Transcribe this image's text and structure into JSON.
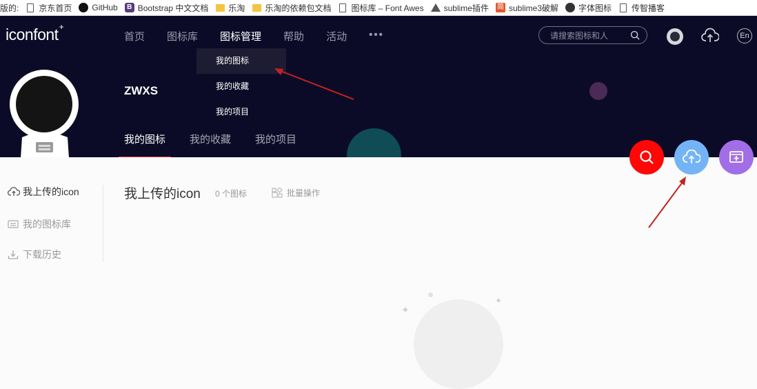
{
  "bookmarks": [
    {
      "label": "版的:",
      "icon": "file-icon"
    },
    {
      "label": "京东首页",
      "icon": "file-icon"
    },
    {
      "label": "GitHub",
      "icon": "github-icon"
    },
    {
      "label": "Bootstrap 中文文档",
      "icon": "bootstrap-icon"
    },
    {
      "label": "乐淘",
      "icon": "folder-icon"
    },
    {
      "label": "乐淘的依赖包文档",
      "icon": "folder-icon"
    },
    {
      "label": "图标库 – Font Awes",
      "icon": "file-icon"
    },
    {
      "label": "sublime插件",
      "icon": "triangle-icon"
    },
    {
      "label": "sublime3破解",
      "icon": "jian-icon"
    },
    {
      "label": "字体图标",
      "icon": "gear-icon"
    },
    {
      "label": "传智播客",
      "icon": "file-icon"
    }
  ],
  "header": {
    "logo": "iconfont",
    "logo_mark": "+",
    "nav": [
      "首页",
      "图标库",
      "图标管理",
      "帮助",
      "活动",
      "•••"
    ],
    "active_nav": "图标管理",
    "search_placeholder": "请搜索图标和人",
    "lang": "En"
  },
  "dropdown": [
    "我的图标",
    "我的收藏",
    "我的项目"
  ],
  "profile": {
    "username": "ZWXS",
    "tabs": [
      "我的图标",
      "我的收藏",
      "我的项目"
    ]
  },
  "sidebar": {
    "items": [
      {
        "label": "我上传的icon",
        "icon": "cloud-upload-icon"
      },
      {
        "label": "我的图标库",
        "icon": "library-icon"
      },
      {
        "label": "下载历史",
        "icon": "download-icon"
      }
    ]
  },
  "main": {
    "title": "我上传的icon",
    "count": "0 个图标",
    "batch_label": "批量操作"
  },
  "colors": {
    "header_bg": "#0c0b27",
    "fab_search": "#ff0707",
    "fab_upload": "#74b4f6",
    "fab_create": "#a26ee7",
    "active_underline": "#e23a3a"
  }
}
